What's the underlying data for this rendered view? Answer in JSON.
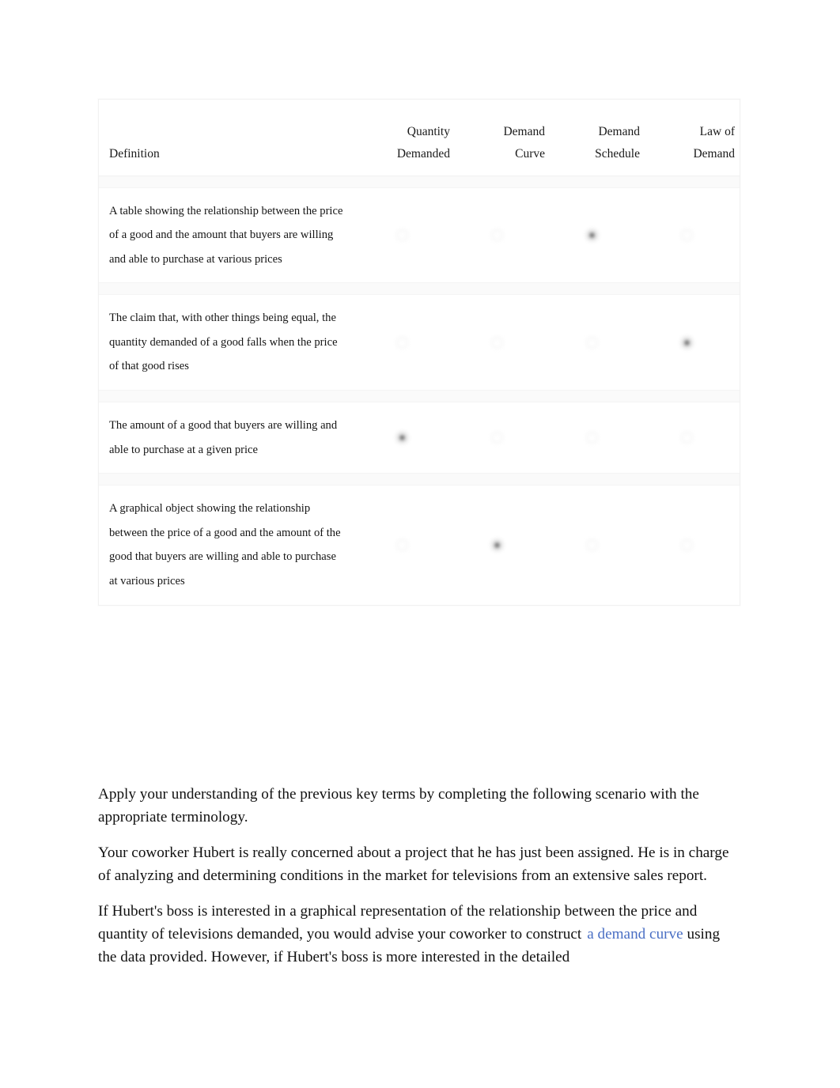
{
  "table": {
    "columns": [
      {
        "id": "definition",
        "label_line1": "",
        "label_line2": "Definition"
      },
      {
        "id": "quantity-demanded",
        "label_line1": "Quantity",
        "label_line2": "Demanded"
      },
      {
        "id": "demand-curve",
        "label_line1": "Demand",
        "label_line2": "Curve"
      },
      {
        "id": "demand-schedule",
        "label_line1": "Demand",
        "label_line2": "Schedule"
      },
      {
        "id": "law-of-demand",
        "label_line1": "Law of",
        "label_line2": "Demand"
      }
    ],
    "rows": [
      {
        "definition": "A table showing the relationship between the price of a good and the amount that buyers are willing and able to purchase at various prices",
        "selected": "demand-schedule"
      },
      {
        "definition": "The claim that, with other things being equal, the quantity demanded of a good falls when the price of that good rises",
        "selected": "law-of-demand"
      },
      {
        "definition": "The amount of a good that buyers are willing and able to purchase at a given price",
        "selected": "quantity-demanded"
      },
      {
        "definition": "A graphical object showing the relationship between the price of a good and the amount of the good that buyers are willing and able to purchase at various prices",
        "selected": "demand-curve"
      }
    ]
  },
  "body": {
    "paragraph1": "Apply your understanding of the previous key terms by completing the following scenario with the appropriate terminology.",
    "paragraph2": "Your coworker Hubert is really concerned about a project that he has just been assigned. He is in charge of analyzing and determining conditions in the market for televisions from an extensive sales report.",
    "paragraph3_part1": "If Hubert's boss is interested in a graphical representation of the relationship between the price and quantity of televisions demanded, you would advise your coworker to construct",
    "paragraph3_answer": "a demand curve",
    "paragraph3_part2": "using the data provided. However, if Hubert's boss is more interested in the detailed"
  },
  "colors": {
    "link_blue": "#4a6fc4",
    "text": "#111111",
    "table_border": "#f1f1f1",
    "row_spacer": "#fafafa"
  }
}
